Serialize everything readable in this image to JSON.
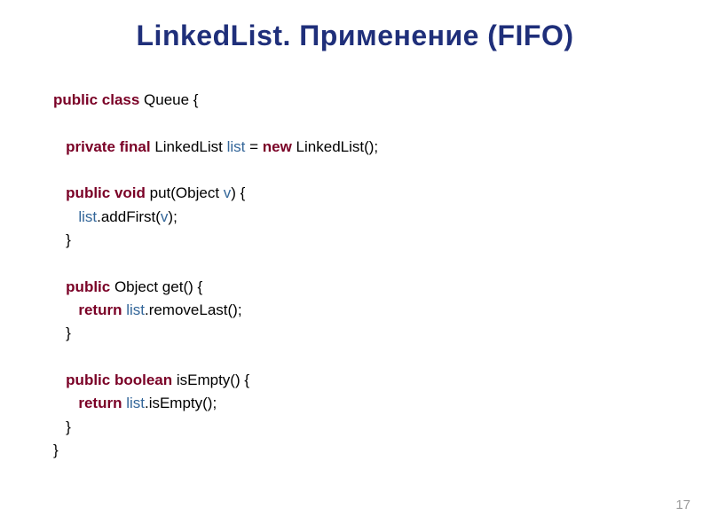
{
  "title": "LinkedList. Применение (FIFO)",
  "code": {
    "l1_kw": "public class ",
    "l1_rest": "Queue {",
    "l2_kw": "private final ",
    "l2_a": "LinkedList ",
    "l2_id": "list",
    "l2_b": " = ",
    "l2_kw2": "new ",
    "l2_c": "LinkedList();",
    "l3_kw": "public void ",
    "l3_a": "put(Object ",
    "l3_id": "v",
    "l3_b": ") {",
    "l4_id": "list",
    "l4_a": ".addFirst(",
    "l4_id2": "v",
    "l4_b": ");",
    "l5": "}",
    "l6_kw": "public ",
    "l6_a": "Object get() {",
    "l7_kw": "return ",
    "l7_id": "list",
    "l7_a": ".removeLast();",
    "l8": "}",
    "l9_kw": "public boolean ",
    "l9_a": "isEmpty() {",
    "l10_kw": "return ",
    "l10_id": "list",
    "l10_a": ".isEmpty();",
    "l11": "}",
    "l12": "}"
  },
  "page_number": "17"
}
